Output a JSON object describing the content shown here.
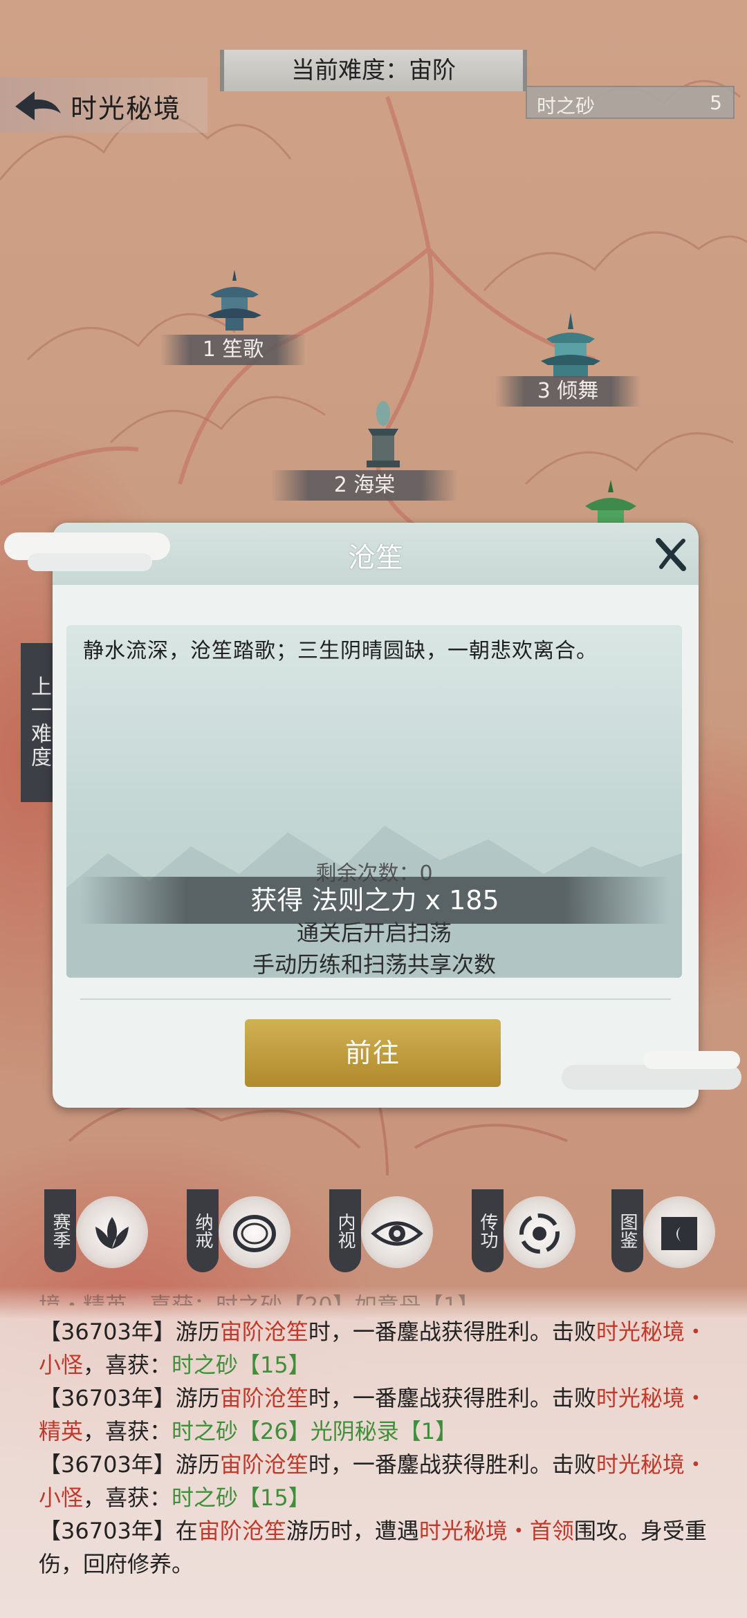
{
  "header": {
    "title": "时光秘境",
    "difficulty": "当前难度：宙阶",
    "currency_name": "时之砂",
    "currency_value": "5"
  },
  "map": {
    "nodes": [
      {
        "label": "1 笙歌"
      },
      {
        "label": "2 海棠"
      },
      {
        "label": "3 倾舞"
      }
    ],
    "prev_difficulty": "上一难度"
  },
  "modal": {
    "title": "沧笙",
    "description": "静水流深，沧笙踏歌；三生阴晴圆缺，一朝悲欢离合。",
    "tip_partial": "剩余次数：0",
    "tip_sweep": "通关后开启扫荡",
    "tip_share": "手动历练和扫荡共享次数",
    "reward": "获得 法则之力 x 185",
    "go_button": "前往"
  },
  "toolbar": {
    "items": [
      {
        "label": "赛季",
        "icon": "lotus-icon"
      },
      {
        "label": "纳戒",
        "icon": "ring-icon"
      },
      {
        "label": "内视",
        "icon": "eye-icon"
      },
      {
        "label": "传功",
        "icon": "swirl-icon"
      },
      {
        "label": "图鉴",
        "icon": "book-icon"
      }
    ]
  },
  "log": {
    "top_partial": "境・精英，喜获：时之砂【20】如意丹【1】",
    "entries": [
      {
        "pre": "【36703年】游历",
        "loc": "宙阶沧笙",
        "mid": "时，一番鏖战获得胜利。击败",
        "enemy": "时光秘境・小怪",
        "post": "，喜获：",
        "loot": "时之砂【15】"
      },
      {
        "pre": "【36703年】游历",
        "loc": "宙阶沧笙",
        "mid": "时，一番鏖战获得胜利。击败",
        "enemy": "时光秘境・精英",
        "post": "，喜获：",
        "loot": "时之砂【26】光阴秘录【1】"
      },
      {
        "pre": "【36703年】游历",
        "loc": "宙阶沧笙",
        "mid": "时，一番鏖战获得胜利。击败",
        "enemy": "时光秘境・小怪",
        "post": "，喜获：",
        "loot": "时之砂【15】"
      }
    ],
    "last": {
      "pre": "【36703年】在",
      "loc": "宙阶沧笙",
      "mid": "游历时，遭遇",
      "enemy": "时光秘境・首领",
      "post": "围攻。身受重伤，回府修养。"
    }
  },
  "colors": {
    "enemy": "#c0392b",
    "loot": "#3f8f3a",
    "button": "#c19a3c"
  }
}
